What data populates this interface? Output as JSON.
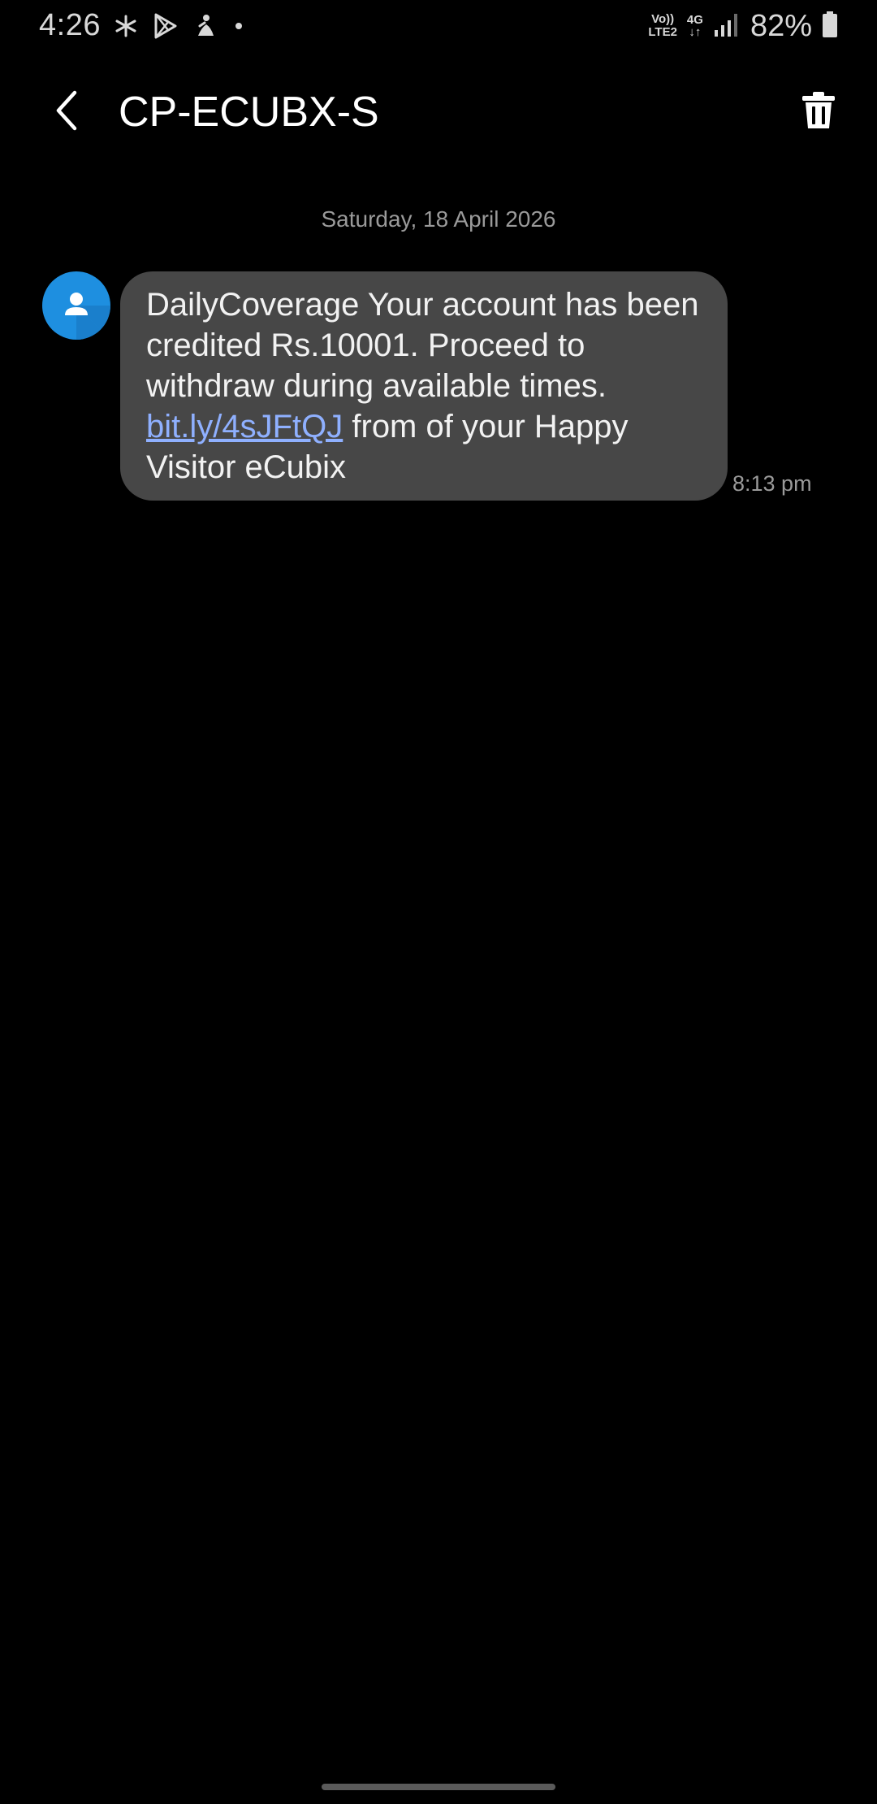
{
  "status_bar": {
    "time": "4:26",
    "icons": [
      "pinwheel-icon",
      "play-store-icon",
      "yoga-person-icon",
      "dot-icon"
    ],
    "volte_top": "Vo))",
    "volte_bottom": "LTE2",
    "network_top": "4G",
    "network_bottom": "↓↑",
    "battery": "82%"
  },
  "app_bar": {
    "title": "CP-ECUBX-S",
    "back_icon": "chevron-left-icon",
    "delete_icon": "trash-icon"
  },
  "conversation": {
    "date": "Saturday, 18 April 2026",
    "messages": [
      {
        "text_before": "DailyCoverage Your account has been credited Rs.10001. Proceed to withdraw during available times. ",
        "link": "bit.ly/4sJFtQJ",
        "text_after": " from of your Happy Visitor eCubix",
        "time": "8:13 pm"
      }
    ]
  },
  "colors": {
    "background": "#000000",
    "bubble": "#474747",
    "avatar": "#1e8fe0",
    "link": "#8fb0ff",
    "muted_text": "#9a9a9a"
  }
}
